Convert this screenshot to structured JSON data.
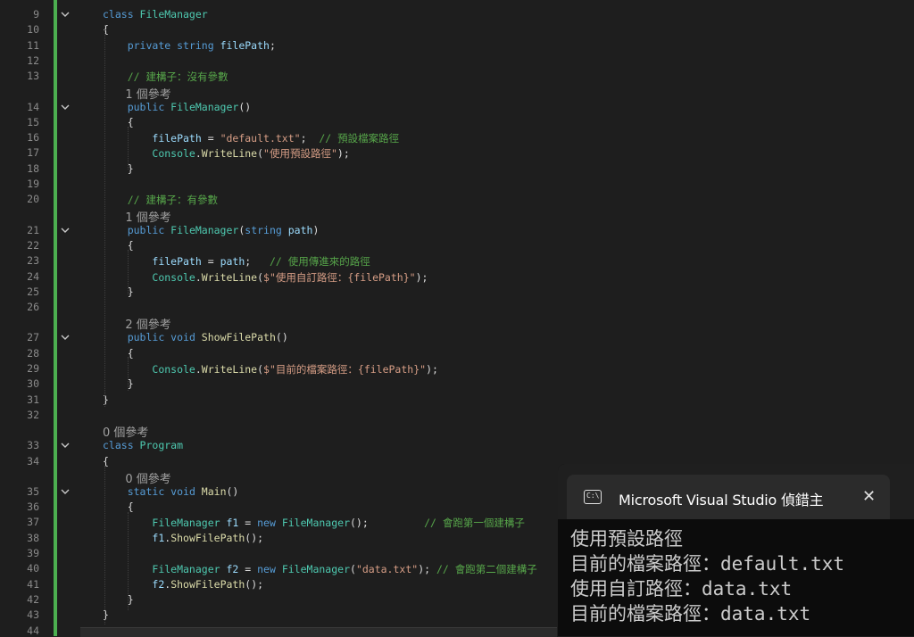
{
  "editor": {
    "rows": [
      {
        "ln": "9",
        "lens": "",
        "fold": "chevron-down",
        "segments": [
          [
            "kw",
            "class "
          ],
          [
            "ty",
            "FileManager"
          ]
        ]
      },
      {
        "ln": "10",
        "lens": "",
        "segments": [
          [
            "pl",
            "{"
          ]
        ]
      },
      {
        "ln": "11",
        "lens": "",
        "segments": [
          [
            "pl",
            "    "
          ],
          [
            "kw",
            "private "
          ],
          [
            "kw",
            "string "
          ],
          [
            "id",
            "filePath"
          ],
          [
            "pl",
            ";"
          ]
        ]
      },
      {
        "ln": "12",
        "lens": "",
        "segments": []
      },
      {
        "ln": "13",
        "lens": "",
        "segments": [
          [
            "pl",
            "    "
          ],
          [
            "cm",
            "// 建構子：沒有參數"
          ]
        ]
      },
      {
        "ln": "14",
        "lens": "1 個參考",
        "fold": "chevron-down",
        "segments": [
          [
            "pl",
            "    "
          ],
          [
            "kw",
            "public "
          ],
          [
            "ty",
            "FileManager"
          ],
          [
            "pl",
            "()"
          ]
        ]
      },
      {
        "ln": "15",
        "lens": "",
        "segments": [
          [
            "pl",
            "    {"
          ]
        ]
      },
      {
        "ln": "16",
        "lens": "",
        "segments": [
          [
            "pl",
            "        "
          ],
          [
            "id",
            "filePath"
          ],
          [
            "pl",
            " = "
          ],
          [
            "str",
            "\"default.txt\""
          ],
          [
            "pl",
            ";  "
          ],
          [
            "cm",
            "// 預設檔案路徑"
          ]
        ]
      },
      {
        "ln": "17",
        "lens": "",
        "segments": [
          [
            "pl",
            "        "
          ],
          [
            "ty",
            "Console"
          ],
          [
            "pl",
            "."
          ],
          [
            "fn",
            "WriteLine"
          ],
          [
            "pl",
            "("
          ],
          [
            "str",
            "\"使用預設路徑\""
          ],
          [
            "pl",
            ");"
          ]
        ]
      },
      {
        "ln": "18",
        "lens": "",
        "segments": [
          [
            "pl",
            "    }"
          ]
        ]
      },
      {
        "ln": "19",
        "lens": "",
        "segments": []
      },
      {
        "ln": "20",
        "lens": "",
        "segments": [
          [
            "pl",
            "    "
          ],
          [
            "cm",
            "// 建構子：有參數"
          ]
        ]
      },
      {
        "ln": "21",
        "lens": "1 個參考",
        "fold": "chevron-down",
        "segments": [
          [
            "pl",
            "    "
          ],
          [
            "kw",
            "public "
          ],
          [
            "ty",
            "FileManager"
          ],
          [
            "pl",
            "("
          ],
          [
            "kw",
            "string "
          ],
          [
            "id",
            "path"
          ],
          [
            "pl",
            ")"
          ]
        ]
      },
      {
        "ln": "22",
        "lens": "",
        "segments": [
          [
            "pl",
            "    {"
          ]
        ]
      },
      {
        "ln": "23",
        "lens": "",
        "segments": [
          [
            "pl",
            "        "
          ],
          [
            "id",
            "filePath"
          ],
          [
            "pl",
            " = "
          ],
          [
            "id",
            "path"
          ],
          [
            "pl",
            ";   "
          ],
          [
            "cm",
            "// 使用傳進來的路徑"
          ]
        ]
      },
      {
        "ln": "24",
        "lens": "",
        "segments": [
          [
            "pl",
            "        "
          ],
          [
            "ty",
            "Console"
          ],
          [
            "pl",
            "."
          ],
          [
            "fn",
            "WriteLine"
          ],
          [
            "pl",
            "("
          ],
          [
            "str",
            "$\"使用自訂路徑：{filePath}\""
          ],
          [
            "pl",
            ");"
          ]
        ]
      },
      {
        "ln": "25",
        "lens": "",
        "segments": [
          [
            "pl",
            "    }"
          ]
        ]
      },
      {
        "ln": "26",
        "lens": "",
        "segments": []
      },
      {
        "ln": "27",
        "lens": "2 個參考",
        "fold": "chevron-down",
        "segments": [
          [
            "pl",
            "    "
          ],
          [
            "kw",
            "public "
          ],
          [
            "kw",
            "void "
          ],
          [
            "fn",
            "ShowFilePath"
          ],
          [
            "pl",
            "()"
          ]
        ]
      },
      {
        "ln": "28",
        "lens": "",
        "segments": [
          [
            "pl",
            "    {"
          ]
        ]
      },
      {
        "ln": "29",
        "lens": "",
        "segments": [
          [
            "pl",
            "        "
          ],
          [
            "ty",
            "Console"
          ],
          [
            "pl",
            "."
          ],
          [
            "fn",
            "WriteLine"
          ],
          [
            "pl",
            "("
          ],
          [
            "str",
            "$\"目前的檔案路徑：{filePath}\""
          ],
          [
            "pl",
            ");"
          ]
        ]
      },
      {
        "ln": "30",
        "lens": "",
        "segments": [
          [
            "pl",
            "    }"
          ]
        ]
      },
      {
        "ln": "31",
        "lens": "",
        "segments": [
          [
            "pl",
            "}"
          ]
        ]
      },
      {
        "ln": "32",
        "lens": "",
        "segments": []
      },
      {
        "ln": "33",
        "lens": "0 個參考",
        "fold": "chevron-down",
        "segments": [
          [
            "kw",
            "class "
          ],
          [
            "ty",
            "Program"
          ]
        ]
      },
      {
        "ln": "34",
        "lens": "",
        "segments": [
          [
            "pl",
            "{"
          ]
        ]
      },
      {
        "ln": "35",
        "lens": "0 個參考",
        "fold": "chevron-down",
        "segments": [
          [
            "pl",
            "    "
          ],
          [
            "kw",
            "static "
          ],
          [
            "kw",
            "void "
          ],
          [
            "fn",
            "Main"
          ],
          [
            "pl",
            "()"
          ]
        ]
      },
      {
        "ln": "36",
        "lens": "",
        "segments": [
          [
            "pl",
            "    {"
          ]
        ]
      },
      {
        "ln": "37",
        "lens": "",
        "segments": [
          [
            "pl",
            "        "
          ],
          [
            "ty",
            "FileManager "
          ],
          [
            "id",
            "f1"
          ],
          [
            "pl",
            " = "
          ],
          [
            "kw",
            "new "
          ],
          [
            "ty",
            "FileManager"
          ],
          [
            "pl",
            "();         "
          ],
          [
            "cm",
            "// 會跑第一個建構子"
          ]
        ]
      },
      {
        "ln": "38",
        "lens": "",
        "segments": [
          [
            "pl",
            "        "
          ],
          [
            "id",
            "f1"
          ],
          [
            "pl",
            "."
          ],
          [
            "fn",
            "ShowFilePath"
          ],
          [
            "pl",
            "();"
          ]
        ]
      },
      {
        "ln": "39",
        "lens": "",
        "segments": []
      },
      {
        "ln": "40",
        "lens": "",
        "segments": [
          [
            "pl",
            "        "
          ],
          [
            "ty",
            "FileManager "
          ],
          [
            "id",
            "f2"
          ],
          [
            "pl",
            " = "
          ],
          [
            "kw",
            "new "
          ],
          [
            "ty",
            "FileManager"
          ],
          [
            "pl",
            "("
          ],
          [
            "str",
            "\"data.txt\""
          ],
          [
            "pl",
            "); "
          ],
          [
            "cm",
            "// 會跑第二個建構子"
          ]
        ]
      },
      {
        "ln": "41",
        "lens": "",
        "segments": [
          [
            "pl",
            "        "
          ],
          [
            "id",
            "f2"
          ],
          [
            "pl",
            "."
          ],
          [
            "fn",
            "ShowFilePath"
          ],
          [
            "pl",
            "();"
          ]
        ]
      },
      {
        "ln": "42",
        "lens": "",
        "segments": [
          [
            "pl",
            "    }"
          ]
        ]
      },
      {
        "ln": "43",
        "lens": "",
        "segments": [
          [
            "pl",
            "}"
          ]
        ]
      },
      {
        "ln": "44",
        "lens": "",
        "segments": []
      }
    ]
  },
  "console": {
    "title": "Microsoft Visual Studio 偵錯主",
    "icon": "C:\\",
    "close_glyph": "✕",
    "output": [
      "使用預設路徑",
      "目前的檔案路徑：default.txt",
      "使用自訂路徑：data.txt",
      "目前的檔案路徑：data.txt"
    ]
  },
  "colors": {
    "keyword": "#569cd6",
    "type": "#4ec9b0",
    "method": "#dcdcaa",
    "string": "#d69d85",
    "comment": "#57a64a",
    "identifier": "#9cdcfe",
    "change_bar": "#4caf50"
  }
}
